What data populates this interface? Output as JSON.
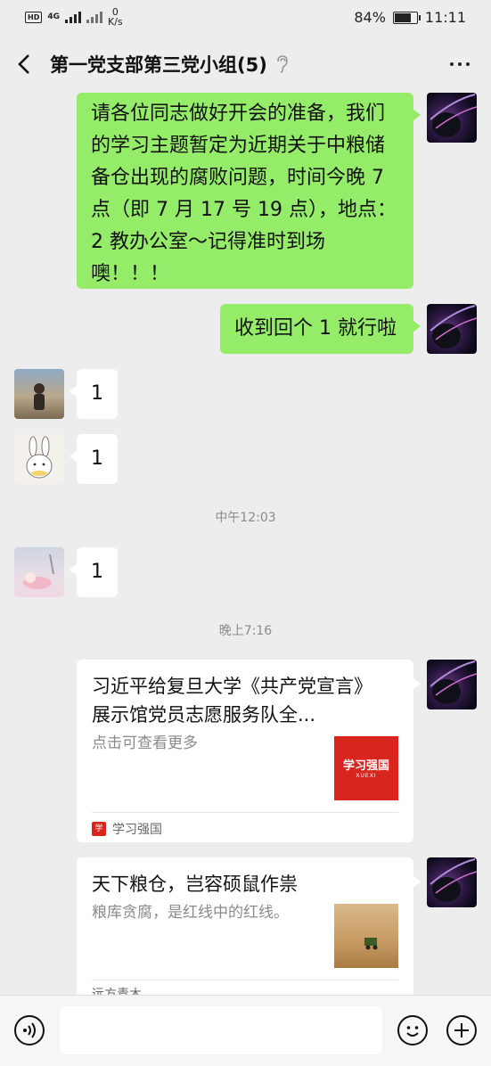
{
  "status_bar": {
    "network_badge": "HD",
    "signal_label": "4G",
    "speed_value": "0",
    "speed_unit": "K/s",
    "battery_percent": "84%",
    "battery_level": 0.84,
    "time": "11:11"
  },
  "header": {
    "title": "第一党支部第三党小组(5)",
    "back_icon": "chevron-left-icon",
    "mute_icon": "ear-icon",
    "more_icon": "more-dots-icon"
  },
  "messages": [
    {
      "from": "me",
      "text": "请各位同志做好开会的准备，我们的学习主题暂定为近期关于中粮储备仓出现的腐败问题，时间今晚 7 点（即 7 月 17 号 19 点），地点：2 教办公室～记得准时到场噢！！！"
    },
    {
      "from": "me",
      "text": "收到回个 1 就行啦"
    },
    {
      "from": "member1",
      "text": "1"
    },
    {
      "from": "member2",
      "text": "1"
    },
    {
      "type": "time",
      "text": "中午12:03"
    },
    {
      "from": "member3",
      "text": "1"
    },
    {
      "type": "time",
      "text": "晚上7:16"
    }
  ],
  "cards": [
    {
      "title": "习近平给复旦大学《共产党宣言》展示馆党员志愿服务队全...",
      "desc": "点击可查看更多",
      "thumb_text": "学习强国",
      "thumb_small": "XUEXI",
      "source": "学习强国"
    },
    {
      "title": "天下粮仓，岂容硕鼠作祟",
      "desc": "粮库贪腐，是红线中的红线。",
      "source": "远方青木"
    }
  ],
  "input_bar": {
    "voice_icon": "voice-icon",
    "emoji_icon": "emoji-icon",
    "plus_icon": "plus-icon"
  },
  "colors": {
    "my_bubble": "#95ec69",
    "background": "#ededed",
    "xuexi_red": "#d8261e"
  }
}
